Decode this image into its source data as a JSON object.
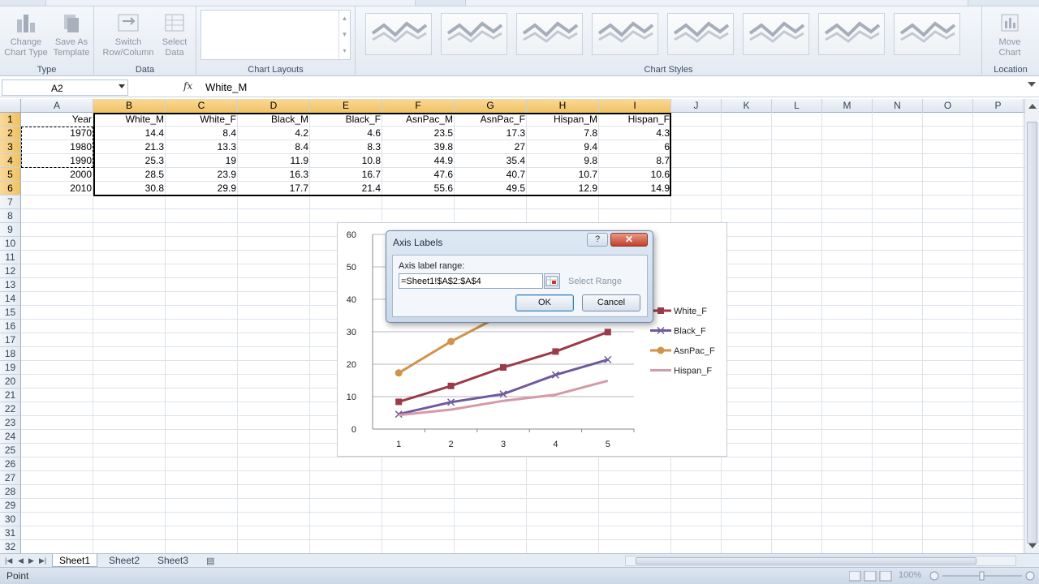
{
  "ribbon": {
    "groups": [
      {
        "label": "Type",
        "buttons": [
          {
            "line1": "Change",
            "line2": "Chart Type"
          },
          {
            "line1": "Save As",
            "line2": "Template"
          }
        ]
      },
      {
        "label": "Data",
        "buttons": [
          {
            "line1": "Switch",
            "line2": "Row/Column"
          },
          {
            "line1": "Select",
            "line2": "Data"
          }
        ]
      },
      {
        "label": "Chart Layouts"
      },
      {
        "label": "Chart Styles"
      },
      {
        "label": "Location",
        "buttons": [
          {
            "line1": "Move",
            "line2": "Chart"
          }
        ]
      }
    ]
  },
  "formula_bar": {
    "name_box": "A2",
    "fx": "fx",
    "content": "White_M"
  },
  "columns": [
    "A",
    "B",
    "C",
    "D",
    "E",
    "F",
    "G",
    "H",
    "I",
    "J",
    "K",
    "L",
    "M",
    "N",
    "O",
    "P"
  ],
  "rows": [
    "1",
    "2",
    "3",
    "4",
    "5",
    "6",
    "7",
    "8",
    "9",
    "10",
    "11",
    "12",
    "13",
    "14",
    "15",
    "16",
    "17",
    "18",
    "19",
    "20",
    "21",
    "22",
    "23",
    "24",
    "25",
    "26",
    "27",
    "28",
    "29",
    "30",
    "31",
    "32"
  ],
  "table": {
    "header": [
      "Year",
      "White_M",
      "White_F",
      "Black_M",
      "Black_F",
      "AsnPac_M",
      "AsnPac_F",
      "Hispan_M",
      "Hispan_F"
    ],
    "rows": [
      [
        "1970",
        "14.4",
        "8.4",
        "4.2",
        "4.6",
        "23.5",
        "17.3",
        "7.8",
        "4.3"
      ],
      [
        "1980",
        "21.3",
        "13.3",
        "8.4",
        "8.3",
        "39.8",
        "27",
        "9.4",
        "6"
      ],
      [
        "1990",
        "25.3",
        "19",
        "11.9",
        "10.8",
        "44.9",
        "35.4",
        "9.8",
        "8.7"
      ],
      [
        "2000",
        "28.5",
        "23.9",
        "16.3",
        "16.7",
        "47.6",
        "40.7",
        "10.7",
        "10.6"
      ],
      [
        "2010",
        "30.8",
        "29.9",
        "17.7",
        "21.4",
        "55.6",
        "49.5",
        "12.9",
        "14.9"
      ]
    ]
  },
  "chart_data": {
    "type": "line",
    "x": [
      1,
      2,
      3,
      4,
      5
    ],
    "ylim": [
      0,
      60
    ],
    "yticks": [
      0,
      10,
      20,
      30,
      40,
      50,
      60
    ],
    "grid": true,
    "legend_position": "right",
    "series": [
      {
        "name": "White_F",
        "values": [
          8.4,
          13.3,
          19,
          23.9,
          29.9
        ],
        "color": "#9b3a4a",
        "marker": "square"
      },
      {
        "name": "Black_F",
        "values": [
          4.6,
          8.3,
          10.8,
          16.7,
          21.4
        ],
        "color": "#6f5a9c",
        "marker": "x"
      },
      {
        "name": "AsnPac_F",
        "values": [
          17.3,
          27,
          35.4,
          40.7,
          49.5
        ],
        "color": "#d1924a",
        "marker": "circle"
      },
      {
        "name": "Hispan_F",
        "values": [
          4.3,
          6,
          8.7,
          10.6,
          14.9
        ],
        "color": "#d59aa8",
        "marker": "none"
      }
    ]
  },
  "dialog": {
    "title": "Axis Labels",
    "help": "?",
    "close": "✕",
    "label": "Axis label range:",
    "value": "=Sheet1!$A$2:$A$4",
    "range_hint": "Select Range",
    "ok": "OK",
    "cancel": "Cancel"
  },
  "sheets": [
    "Sheet1",
    "Sheet2",
    "Sheet3"
  ],
  "status": {
    "mode": "Point",
    "zoom": "100%"
  },
  "colors": {
    "selected_header": "#f1c15f",
    "ribbon": "#e4eaf2"
  }
}
